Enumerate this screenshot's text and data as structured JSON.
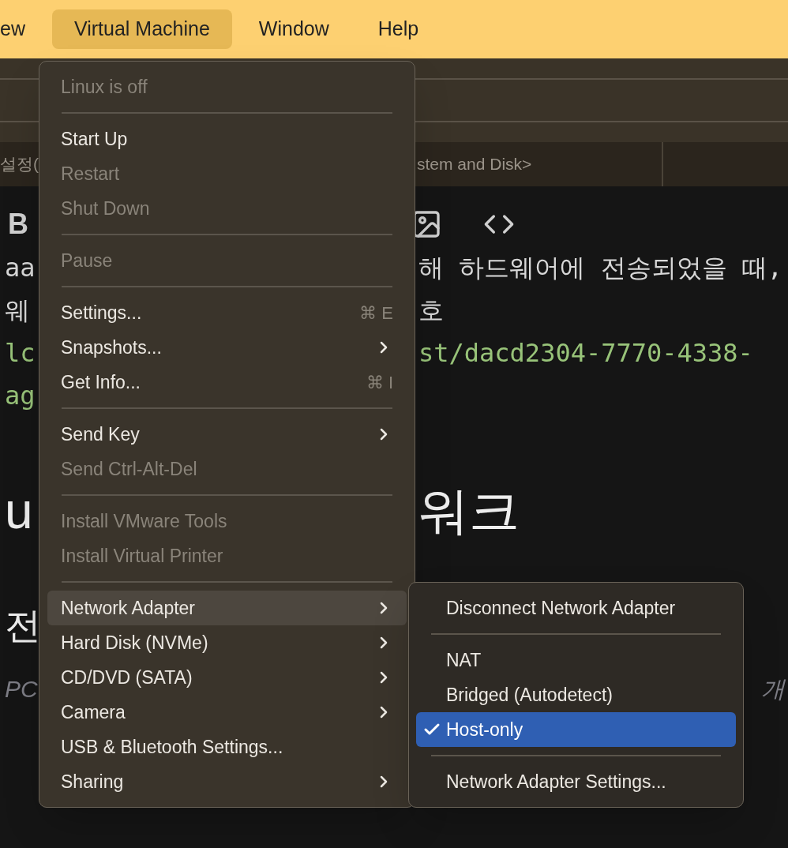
{
  "menubar": [
    {
      "label": "ew",
      "selected": false
    },
    {
      "label": "Virtual Machine",
      "selected": true
    },
    {
      "label": "Window",
      "selected": false
    },
    {
      "label": "Help",
      "selected": false
    }
  ],
  "background": {
    "tabs": [
      {
        "label": "설정("
      },
      {
        "label": "stem and Disk>"
      }
    ],
    "toolbar": {
      "bold": "B"
    },
    "rows": [
      {
        "kind": "mono",
        "left": "aa",
        "right": "해 하드웨어에 전송되었을 때,"
      },
      {
        "kind": "mono",
        "left": "웨",
        "right": "호"
      },
      {
        "kind": "link",
        "left": "lc",
        "right": "st/dacd2304-7770-4338-"
      },
      {
        "kind": "link",
        "left": "ag",
        "right": ""
      },
      {
        "kind": "h1",
        "left": "u",
        "right": "워크"
      },
      {
        "kind": "h2",
        "left": "전",
        "right": ""
      },
      {
        "kind": "note",
        "left": "PC",
        "right": "개"
      }
    ]
  },
  "menu": {
    "groups": [
      [
        {
          "label": "Linux is off",
          "disabled": true,
          "selected": false
        }
      ],
      [
        {
          "label": "Start Up",
          "disabled": false,
          "selected": false
        },
        {
          "label": "Restart",
          "disabled": true,
          "selected": false
        },
        {
          "label": "Shut Down",
          "disabled": true,
          "selected": false
        }
      ],
      [
        {
          "label": "Pause",
          "disabled": true,
          "selected": false
        }
      ],
      [
        {
          "label": "Settings...",
          "disabled": false,
          "selected": false,
          "shortcut": "⌘ E"
        },
        {
          "label": "Snapshots...",
          "disabled": false,
          "selected": false,
          "submenu": true
        },
        {
          "label": "Get Info...",
          "disabled": false,
          "selected": false,
          "shortcut": "⌘ I"
        }
      ],
      [
        {
          "label": "Send Key",
          "disabled": false,
          "selected": false,
          "submenu": true
        },
        {
          "label": "Send Ctrl-Alt-Del",
          "disabled": true,
          "selected": false
        }
      ],
      [
        {
          "label": "Install VMware Tools",
          "disabled": true,
          "selected": false
        },
        {
          "label": "Install Virtual Printer",
          "disabled": true,
          "selected": false
        }
      ],
      [
        {
          "label": "Network Adapter",
          "disabled": false,
          "selected": true,
          "submenu": true
        },
        {
          "label": "Hard Disk (NVMe)",
          "disabled": false,
          "selected": false,
          "submenu": true
        },
        {
          "label": "CD/DVD (SATA)",
          "disabled": false,
          "selected": false,
          "submenu": true
        },
        {
          "label": "Camera",
          "disabled": false,
          "selected": false,
          "submenu": true
        },
        {
          "label": "USB & Bluetooth Settings...",
          "disabled": false,
          "selected": false
        },
        {
          "label": "Sharing",
          "disabled": false,
          "selected": false,
          "submenu": true
        }
      ]
    ]
  },
  "submenu": {
    "groups": [
      [
        {
          "label": "Disconnect Network Adapter",
          "checked": false,
          "selected": false
        }
      ],
      [
        {
          "label": "NAT",
          "checked": false,
          "selected": false
        },
        {
          "label": "Bridged (Autodetect)",
          "checked": false,
          "selected": false
        },
        {
          "label": "Host-only",
          "checked": true,
          "selected": true
        }
      ],
      [
        {
          "label": "Network Adapter Settings...",
          "checked": false,
          "selected": false
        }
      ]
    ]
  }
}
